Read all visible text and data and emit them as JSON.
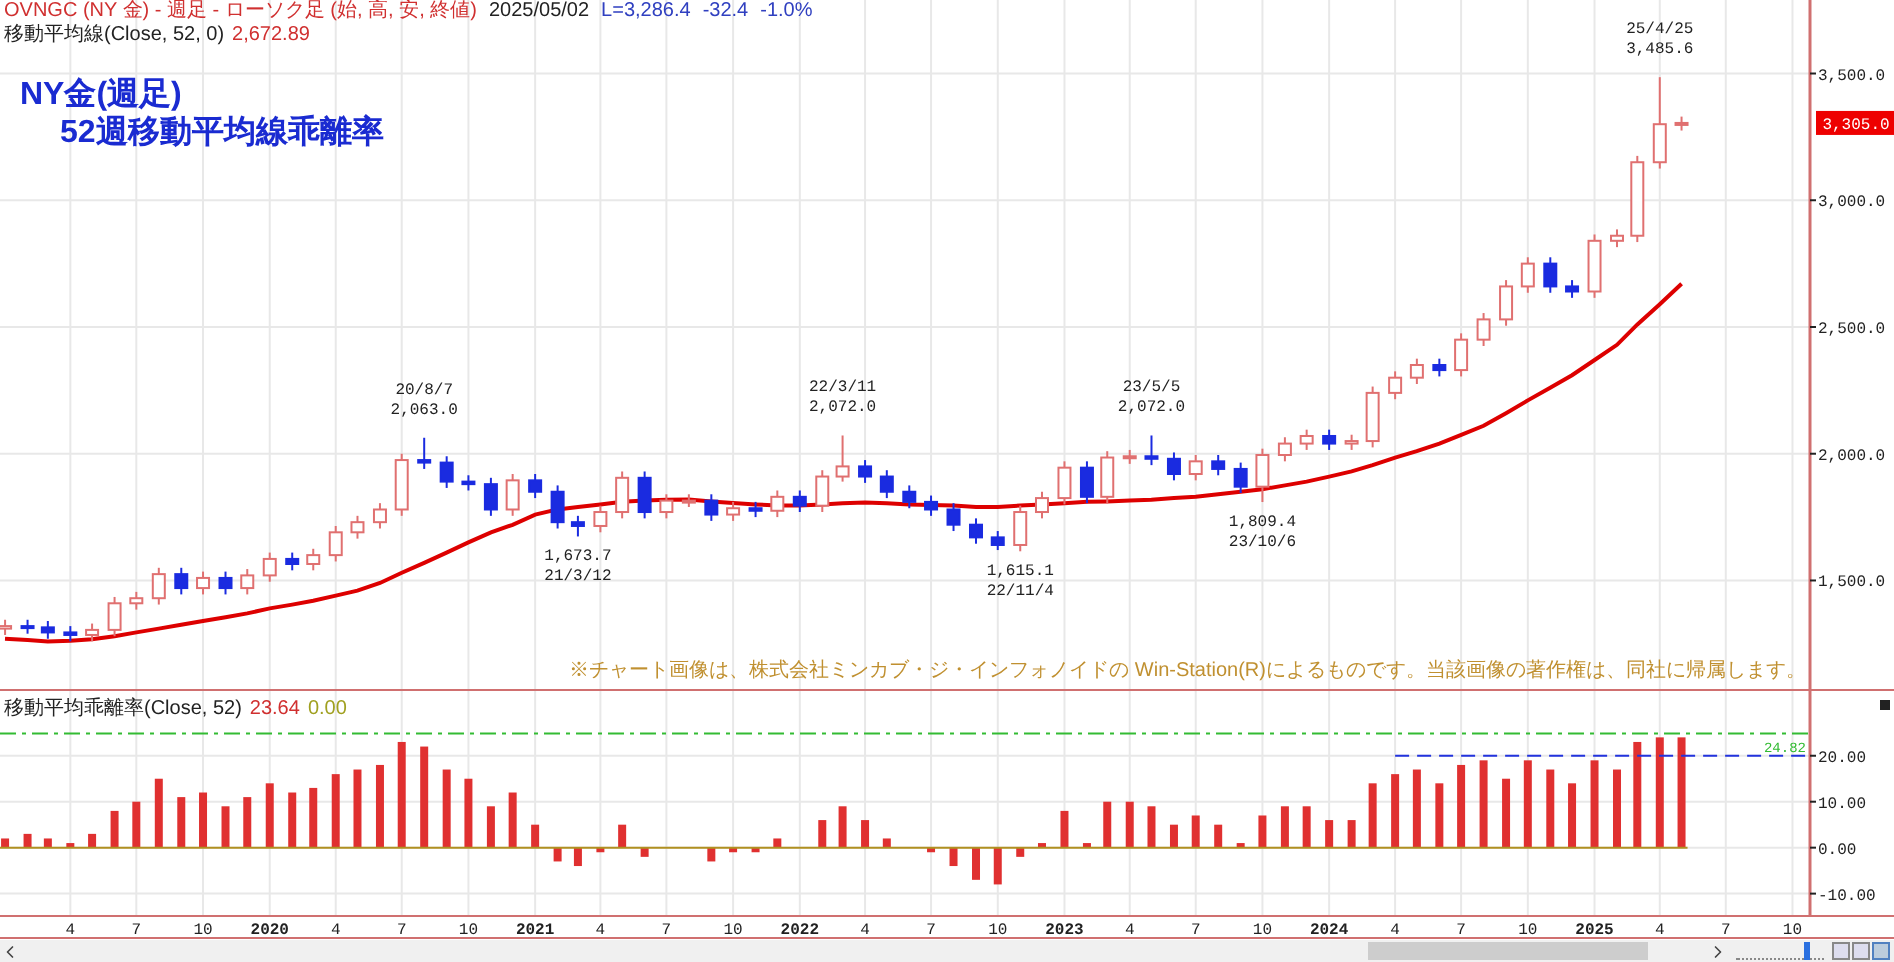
{
  "header": {
    "symbol_line": "OVNGC (NY 金) - 週足 - ローソク足 (始, 高, 安, 終値)",
    "date": "2025/05/02",
    "last": "L=3,286.4",
    "change": "-32.4",
    "change_pct": "-1.0%",
    "ma_value": "2,672.89"
  },
  "title": [
    "NY金(週足)",
    "52週移動平均線乖離率"
  ],
  "price_chart": {
    "current_price": "3,305.0",
    "chart_data": {
      "type": "candlestick",
      "grid": true,
      "ylim": [
        1060,
        3790
      ],
      "xlim": [
        "2018-12-25",
        "2026-02-18"
      ],
      "x": [
        "2019-01",
        "2019-02",
        "2019-03",
        "2019-04",
        "2019-05",
        "2019-06",
        "2019-07",
        "2019-08",
        "2019-09",
        "2019-10",
        "2019-11",
        "2019-12",
        "2020-01",
        "2020-02",
        "2020-03",
        "2020-04",
        "2020-05",
        "2020-06",
        "2020-07",
        "2020-08",
        "2020-09",
        "2020-10",
        "2020-11",
        "2020-12",
        "2021-01",
        "2021-02",
        "2021-03",
        "2021-04",
        "2021-05",
        "2021-06",
        "2021-07",
        "2021-08",
        "2021-09",
        "2021-10",
        "2021-11",
        "2021-12",
        "2022-01",
        "2022-02",
        "2022-03",
        "2022-04",
        "2022-05",
        "2022-06",
        "2022-07",
        "2022-08",
        "2022-09",
        "2022-10",
        "2022-11",
        "2022-12",
        "2023-01",
        "2023-02",
        "2023-03",
        "2023-04",
        "2023-05",
        "2023-06",
        "2023-07",
        "2023-08",
        "2023-09",
        "2023-10",
        "2023-11",
        "2023-12",
        "2024-01",
        "2024-02",
        "2024-03",
        "2024-04",
        "2024-05",
        "2024-06",
        "2024-07",
        "2024-08",
        "2024-09",
        "2024-10",
        "2024-11",
        "2024-12",
        "2025-01",
        "2025-02",
        "2025-03",
        "2025-04",
        "2025-05"
      ],
      "ohlc": [
        [
          1310,
          1345,
          1285,
          1320
        ],
        [
          1320,
          1345,
          1290,
          1315
        ],
        [
          1315,
          1340,
          1270,
          1295
        ],
        [
          1295,
          1320,
          1260,
          1285
        ],
        [
          1285,
          1330,
          1260,
          1305
        ],
        [
          1305,
          1435,
          1280,
          1410
        ],
        [
          1410,
          1455,
          1385,
          1430
        ],
        [
          1430,
          1550,
          1405,
          1525
        ],
        [
          1525,
          1550,
          1445,
          1470
        ],
        [
          1470,
          1535,
          1445,
          1510
        ],
        [
          1510,
          1535,
          1445,
          1470
        ],
        [
          1470,
          1545,
          1445,
          1520
        ],
        [
          1520,
          1610,
          1495,
          1585
        ],
        [
          1585,
          1610,
          1540,
          1565
        ],
        [
          1565,
          1625,
          1540,
          1600
        ],
        [
          1600,
          1715,
          1575,
          1690
        ],
        [
          1690,
          1755,
          1665,
          1730
        ],
        [
          1730,
          1805,
          1705,
          1780
        ],
        [
          1780,
          2000,
          1755,
          1975
        ],
        [
          1975,
          2063,
          1940,
          1965
        ],
        [
          1965,
          1990,
          1865,
          1890
        ],
        [
          1890,
          1915,
          1855,
          1880
        ],
        [
          1880,
          1905,
          1755,
          1780
        ],
        [
          1780,
          1920,
          1755,
          1895
        ],
        [
          1895,
          1920,
          1825,
          1850
        ],
        [
          1850,
          1875,
          1705,
          1730
        ],
        [
          1730,
          1755,
          1673.7,
          1715
        ],
        [
          1715,
          1795,
          1690,
          1770
        ],
        [
          1770,
          1930,
          1745,
          1905
        ],
        [
          1905,
          1930,
          1745,
          1770
        ],
        [
          1770,
          1840,
          1745,
          1815
        ],
        [
          1815,
          1840,
          1790,
          1815
        ],
        [
          1815,
          1840,
          1735,
          1760
        ],
        [
          1760,
          1810,
          1735,
          1785
        ],
        [
          1785,
          1810,
          1750,
          1775
        ],
        [
          1775,
          1855,
          1750,
          1830
        ],
        [
          1830,
          1855,
          1770,
          1795
        ],
        [
          1795,
          1935,
          1770,
          1910
        ],
        [
          1910,
          2072,
          1890,
          1950
        ],
        [
          1950,
          1975,
          1885,
          1910
        ],
        [
          1910,
          1935,
          1825,
          1850
        ],
        [
          1850,
          1875,
          1785,
          1810
        ],
        [
          1810,
          1835,
          1755,
          1780
        ],
        [
          1780,
          1805,
          1695,
          1720
        ],
        [
          1720,
          1745,
          1645,
          1670
        ],
        [
          1670,
          1695,
          1620,
          1640
        ],
        [
          1640,
          1795,
          1615.1,
          1770
        ],
        [
          1770,
          1850,
          1745,
          1825
        ],
        [
          1825,
          1970,
          1800,
          1945
        ],
        [
          1945,
          1970,
          1805,
          1830
        ],
        [
          1830,
          2010,
          1805,
          1985
        ],
        [
          1985,
          2015,
          1960,
          1990
        ],
        [
          1990,
          2072,
          1955,
          1980
        ],
        [
          1980,
          2005,
          1895,
          1920
        ],
        [
          1920,
          1995,
          1895,
          1970
        ],
        [
          1970,
          1995,
          1915,
          1940
        ],
        [
          1940,
          1965,
          1845,
          1870
        ],
        [
          1870,
          2020,
          1809.4,
          1995
        ],
        [
          1995,
          2065,
          1970,
          2040
        ],
        [
          2040,
          2095,
          2015,
          2070
        ],
        [
          2070,
          2095,
          2015,
          2040
        ],
        [
          2040,
          2075,
          2015,
          2050
        ],
        [
          2050,
          2265,
          2025,
          2240
        ],
        [
          2240,
          2325,
          2215,
          2300
        ],
        [
          2300,
          2375,
          2275,
          2350
        ],
        [
          2350,
          2375,
          2305,
          2330
        ],
        [
          2330,
          2475,
          2305,
          2450
        ],
        [
          2450,
          2555,
          2425,
          2530
        ],
        [
          2530,
          2685,
          2505,
          2660
        ],
        [
          2660,
          2775,
          2635,
          2750
        ],
        [
          2750,
          2775,
          2635,
          2660
        ],
        [
          2660,
          2685,
          2615,
          2640
        ],
        [
          2640,
          2865,
          2615,
          2840
        ],
        [
          2840,
          2885,
          2815,
          2860
        ],
        [
          2860,
          3175,
          2835,
          3150
        ],
        [
          3150,
          3485.6,
          3125,
          3300
        ],
        [
          3300,
          3330,
          3275,
          3305
        ]
      ],
      "series": [
        {
          "name": "移動平均線(Close, 52, 0)",
          "type": "line",
          "color": "#dd0000",
          "values": [
            1270,
            1265,
            1260,
            1262,
            1268,
            1280,
            1295,
            1310,
            1325,
            1340,
            1355,
            1370,
            1390,
            1405,
            1420,
            1440,
            1460,
            1490,
            1530,
            1570,
            1610,
            1650,
            1690,
            1720,
            1760,
            1780,
            1790,
            1800,
            1810,
            1815,
            1818,
            1820,
            1812,
            1806,
            1800,
            1795,
            1795,
            1800,
            1805,
            1808,
            1805,
            1800,
            1798,
            1795,
            1790,
            1790,
            1795,
            1800,
            1805,
            1810,
            1812,
            1815,
            1818,
            1825,
            1830,
            1840,
            1850,
            1860,
            1875,
            1890,
            1910,
            1930,
            1955,
            1985,
            2010,
            2040,
            2075,
            2110,
            2160,
            2210,
            2260,
            2310,
            2370,
            2430,
            2510,
            2590,
            2670
          ]
        }
      ],
      "yticks": [
        {
          "value": 1500,
          "label": "1,500.0"
        },
        {
          "value": 2000,
          "label": "2,000.0"
        },
        {
          "value": 2500,
          "label": "2,500.0"
        },
        {
          "value": 3000,
          "label": "3,000.0"
        },
        {
          "value": 3500,
          "label": "3,500.0"
        }
      ],
      "annotations": [
        {
          "x": "2020-08",
          "y": 2063,
          "text": "20/8/7 2,063.0"
        },
        {
          "x": "2021-03",
          "y": 1673.7,
          "text": "1,673.7 21/3/12"
        },
        {
          "x": "2022-03",
          "y": 2072,
          "text": "22/3/11 2,072.0"
        },
        {
          "x": "2022-11",
          "y": 1615.1,
          "text": "1,615.1 22/11/4"
        },
        {
          "x": "2023-05",
          "y": 2072,
          "text": "23/5/5 2,072.0"
        },
        {
          "x": "2023-10",
          "y": 1809.4,
          "text": "1,809.4 23/10/6"
        },
        {
          "x": "2025-04",
          "y": 3485.6,
          "text": "25/4/25 3,485.6"
        }
      ]
    }
  },
  "notice": "※チャート画像は、株式会社ミンカブ・ジ・インフォノイドの Win-Station(R)によるものです。当該画像の著作権は、同社に帰属します。",
  "deviation_chart": {
    "label": "移動平均乖離率(Close, 52)",
    "value": "23.64",
    "zero_value": "0.00",
    "chart_data": {
      "type": "bar",
      "grid": true,
      "ylim": [
        -14,
        33
      ],
      "xlim": [
        "2018-12-25",
        "2026-02-18"
      ],
      "x": [
        "2019-01",
        "2019-02",
        "2019-03",
        "2019-04",
        "2019-05",
        "2019-06",
        "2019-07",
        "2019-08",
        "2019-09",
        "2019-10",
        "2019-11",
        "2019-12",
        "2020-01",
        "2020-02",
        "2020-03",
        "2020-04",
        "2020-05",
        "2020-06",
        "2020-07",
        "2020-08",
        "2020-09",
        "2020-10",
        "2020-11",
        "2020-12",
        "2021-01",
        "2021-02",
        "2021-03",
        "2021-04",
        "2021-05",
        "2021-06",
        "2021-07",
        "2021-08",
        "2021-09",
        "2021-10",
        "2021-11",
        "2021-12",
        "2022-01",
        "2022-02",
        "2022-03",
        "2022-04",
        "2022-05",
        "2022-06",
        "2022-07",
        "2022-08",
        "2022-09",
        "2022-10",
        "2022-11",
        "2022-12",
        "2023-01",
        "2023-02",
        "2023-03",
        "2023-04",
        "2023-05",
        "2023-06",
        "2023-07",
        "2023-08",
        "2023-09",
        "2023-10",
        "2023-11",
        "2023-12",
        "2024-01",
        "2024-02",
        "2024-03",
        "2024-04",
        "2024-05",
        "2024-06",
        "2024-07",
        "2024-08",
        "2024-09",
        "2024-10",
        "2024-11",
        "2024-12",
        "2025-01",
        "2025-02",
        "2025-03",
        "2025-04",
        "2025-05"
      ],
      "xticks": [
        {
          "value": "2019-04",
          "label": "4"
        },
        {
          "value": "2019-07",
          "label": "7"
        },
        {
          "value": "2019-10",
          "label": "10"
        },
        {
          "value": "2020-01",
          "label": "2020"
        },
        {
          "value": "2020-04",
          "label": "4"
        },
        {
          "value": "2020-07",
          "label": "7"
        },
        {
          "value": "2020-10",
          "label": "10"
        },
        {
          "value": "2021-01",
          "label": "2021"
        },
        {
          "value": "2021-04",
          "label": "4"
        },
        {
          "value": "2021-07",
          "label": "7"
        },
        {
          "value": "2021-10",
          "label": "10"
        },
        {
          "value": "2022-01",
          "label": "2022"
        },
        {
          "value": "2022-04",
          "label": "4"
        },
        {
          "value": "2022-07",
          "label": "7"
        },
        {
          "value": "2022-10",
          "label": "10"
        },
        {
          "value": "2023-01",
          "label": "2023"
        },
        {
          "value": "2023-04",
          "label": "4"
        },
        {
          "value": "2023-07",
          "label": "7"
        },
        {
          "value": "2023-10",
          "label": "10"
        },
        {
          "value": "2024-01",
          "label": "2024"
        },
        {
          "value": "2024-04",
          "label": "4"
        },
        {
          "value": "2024-07",
          "label": "7"
        },
        {
          "value": "2024-10",
          "label": "10"
        },
        {
          "value": "2025-01",
          "label": "2025"
        },
        {
          "value": "2025-04",
          "label": "4"
        },
        {
          "value": "2025-07",
          "label": "7"
        },
        {
          "value": "2025-10",
          "label": "10"
        }
      ],
      "series": [
        {
          "color": "#e03030",
          "values": [
            2,
            3,
            2,
            1,
            3,
            8,
            10,
            15,
            11,
            12,
            9,
            11,
            14,
            12,
            13,
            16,
            17,
            18,
            23,
            22,
            17,
            15,
            9,
            12,
            5,
            -3,
            -4,
            -1,
            5,
            -2,
            0,
            0,
            -3,
            -1,
            -1,
            2,
            0,
            6,
            9,
            6,
            2,
            0,
            -1,
            -4,
            -7,
            -8,
            -2,
            1,
            8,
            1,
            10,
            10,
            9,
            5,
            7,
            5,
            1,
            7,
            9,
            9,
            6,
            6,
            14,
            16,
            17,
            14,
            18,
            19,
            15,
            19,
            17,
            14,
            19,
            17,
            23,
            24,
            24
          ]
        }
      ],
      "yticks": [
        {
          "value": -10,
          "label": "-10.00"
        },
        {
          "value": 0,
          "label": "0.00"
        },
        {
          "value": 10,
          "label": "10.00"
        },
        {
          "value": 20,
          "label": "20.00"
        }
      ],
      "ref_lines": [
        {
          "axis": "y",
          "value": 24.82,
          "label": "24.82"
        },
        {
          "axis": "y",
          "value": 20
        },
        {
          "axis": "y",
          "value": 0
        }
      ]
    }
  },
  "zoom_slider": {
    "level": 0.85
  }
}
